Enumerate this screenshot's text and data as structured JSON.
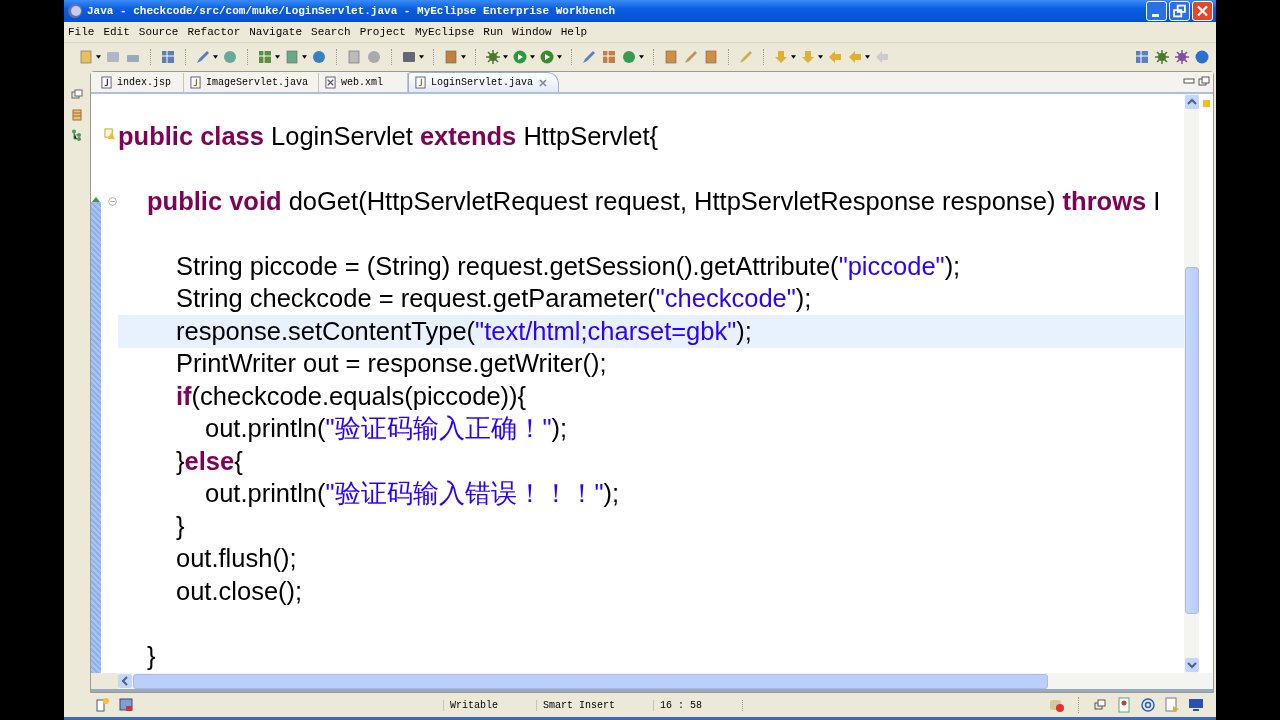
{
  "window": {
    "title": "Java - checkcode/src/com/muke/LoginServlet.java - MyEclipse Enterprise Workbench"
  },
  "menu": [
    "File",
    "Edit",
    "Source",
    "Refactor",
    "Navigate",
    "Search",
    "Project",
    "MyEclipse",
    "Run",
    "Window",
    "Help"
  ],
  "tabs": [
    {
      "label": "index.jsp",
      "kind": "jsp",
      "selected": false
    },
    {
      "label": "ImageServlet.java",
      "kind": "java",
      "selected": false
    },
    {
      "label": "web.xml",
      "kind": "xml",
      "selected": false
    },
    {
      "label": "LoginServlet.java",
      "kind": "java",
      "selected": true
    }
  ],
  "lines": [
    {
      "current": false,
      "kind": "warning",
      "tokens": [
        {
          "kind": "keyword",
          "text": "public class "
        },
        {
          "kind": "plain",
          "text": "LoginServlet "
        },
        {
          "kind": "keyword",
          "text": "extends "
        },
        {
          "kind": "plain",
          "text": "HttpServlet{"
        }
      ]
    },
    {
      "current": false
    },
    {
      "current": false,
      "kind": "fold",
      "tokens": [
        {
          "kind": "keyword",
          "text": "\tpublic void "
        },
        {
          "kind": "plain",
          "text": "doGet(HttpServletRequest request, HttpServletResponse response) "
        },
        {
          "kind": "keyword",
          "text": "throws "
        },
        {
          "kind": "plain",
          "text": "I"
        }
      ]
    },
    {
      "current": false
    },
    {
      "current": false,
      "tokens": [
        {
          "kind": "plain",
          "text": "\t\tString piccode = (String) request.getSession().getAttribute("
        },
        {
          "kind": "string",
          "text": "\"piccode\""
        },
        {
          "kind": "plain",
          "text": ");"
        }
      ]
    },
    {
      "current": false,
      "tokens": [
        {
          "kind": "plain",
          "text": "\t\tString checkcode = request.getParameter("
        },
        {
          "kind": "string",
          "text": "\"checkcode\""
        },
        {
          "kind": "plain",
          "text": ");"
        }
      ]
    },
    {
      "current": true,
      "tokens": [
        {
          "kind": "plain",
          "text": "\t\tresponse.setContentType("
        },
        {
          "kind": "string",
          "text": "\"text/html;charset=gbk\""
        },
        {
          "kind": "plain",
          "text": ");"
        }
      ]
    },
    {
      "current": false,
      "tokens": [
        {
          "kind": "plain",
          "text": "\t\tPrintWriter out = response.getWriter();"
        }
      ]
    },
    {
      "current": false,
      "tokens": [
        {
          "kind": "keyword",
          "text": "\t\tif"
        },
        {
          "kind": "plain",
          "text": "(checkcode.equals(piccode)){"
        }
      ]
    },
    {
      "current": false,
      "tokens": [
        {
          "kind": "plain",
          "text": "\t\t\tout.println("
        },
        {
          "kind": "string",
          "text": "\"验证码输入正确！\""
        },
        {
          "kind": "plain",
          "text": ");"
        }
      ]
    },
    {
      "current": false,
      "tokens": [
        {
          "kind": "plain",
          "text": "\t\t}"
        },
        {
          "kind": "keyword",
          "text": "else"
        },
        {
          "kind": "plain",
          "text": "{"
        }
      ]
    },
    {
      "current": false,
      "tokens": [
        {
          "kind": "plain",
          "text": "\t\t\tout.println("
        },
        {
          "kind": "string",
          "text": "\"验证码输入错误！！！\""
        },
        {
          "kind": "plain",
          "text": ");"
        }
      ]
    },
    {
      "current": false,
      "tokens": [
        {
          "kind": "plain",
          "text": "\t\t}"
        }
      ]
    },
    {
      "current": false,
      "tokens": [
        {
          "kind": "plain",
          "text": "\t\tout.flush();"
        }
      ]
    },
    {
      "current": false,
      "tokens": [
        {
          "kind": "plain",
          "text": "\t\tout.close();"
        }
      ]
    },
    {
      "current": false
    },
    {
      "current": false,
      "tokens": [
        {
          "kind": "plain",
          "text": "\t}"
        }
      ]
    }
  ],
  "status_bar": {
    "mode": "Writable",
    "insert": "Smart Insert",
    "position": "16 : 58"
  }
}
